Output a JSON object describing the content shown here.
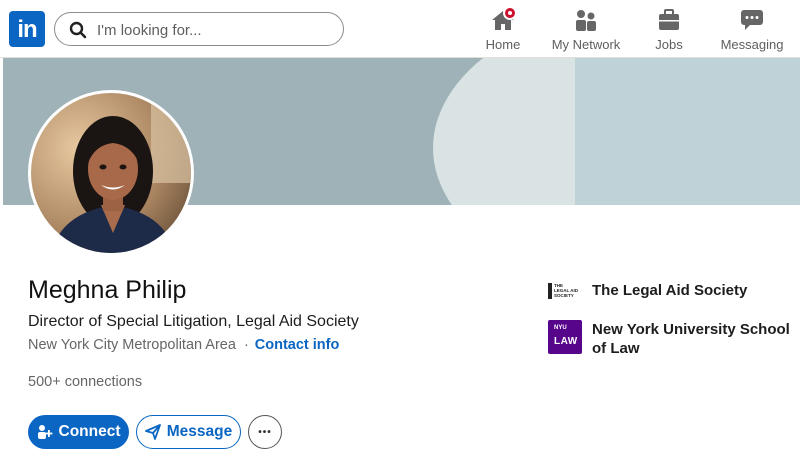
{
  "nav": {
    "logo_text": "in",
    "search_placeholder": "I'm looking for...",
    "items": [
      {
        "label": "Home",
        "icon": "home-icon"
      },
      {
        "label": "My Network",
        "icon": "network-icon"
      },
      {
        "label": "Jobs",
        "icon": "briefcase-icon"
      },
      {
        "label": "Messaging",
        "icon": "messaging-icon"
      }
    ]
  },
  "profile": {
    "name": "Meghna Philip",
    "headline": "Director of Special Litigation, Legal Aid Society",
    "location": "New York City Metropolitan Area",
    "separator": "·",
    "contact_info": "Contact info",
    "connections": "500+ connections"
  },
  "actions": {
    "connect": "Connect",
    "message": "Message",
    "more": "•••"
  },
  "organizations": [
    {
      "name": "The Legal Aid Society",
      "logo_text": "THE LEGAL AID SOCIETY"
    },
    {
      "name": "New York University School of Law",
      "logo_small": "NYU",
      "logo_big": "LAW"
    }
  ],
  "colors": {
    "brand": "#0a66c2",
    "notification": "#cb112d",
    "nyu_purple": "#57068c"
  }
}
